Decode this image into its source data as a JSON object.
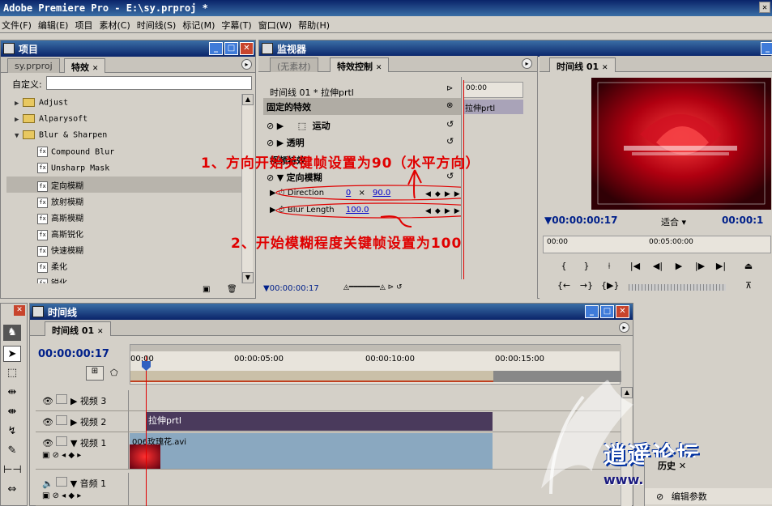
{
  "app": {
    "title": "Adobe Premiere Pro - E:\\sy.prproj *"
  },
  "menu": [
    "文件(F)",
    "编辑(E)",
    "项目",
    "素材(C)",
    "时间线(S)",
    "标记(M)",
    "字幕(T)",
    "窗口(W)",
    "帮助(H)"
  ],
  "project_panel": {
    "title": "项目",
    "tabs": [
      "sy.prproj",
      "特效"
    ],
    "search_label": "自定义:",
    "tree": [
      {
        "label": "Adjust",
        "type": "folder",
        "expanded": false
      },
      {
        "label": "Alparysoft",
        "type": "folder",
        "expanded": false
      },
      {
        "label": "Blur & Sharpen",
        "type": "folder",
        "expanded": true
      },
      {
        "label": "Compound Blur",
        "type": "effect"
      },
      {
        "label": "Unsharp Mask",
        "type": "effect"
      },
      {
        "label": "定向模糊",
        "type": "effect",
        "selected": true
      },
      {
        "label": "放射模糊",
        "type": "effect"
      },
      {
        "label": "高斯模糊",
        "type": "effect"
      },
      {
        "label": "高斯锐化",
        "type": "effect"
      },
      {
        "label": "快速模糊",
        "type": "effect"
      },
      {
        "label": "柔化",
        "type": "effect"
      },
      {
        "label": "锐化",
        "type": "effect"
      }
    ]
  },
  "monitor_panel": {
    "title": "监视器",
    "tabs": [
      "(无素材)",
      "特效控制"
    ],
    "effect_controls": {
      "clip_path": "时间线 01 * 拉伸prtl",
      "fixed_effects": "固定的特效",
      "rows": [
        "运动",
        "透明"
      ],
      "video_effects": "视频特效",
      "effect_name": "定向模糊",
      "params": [
        {
          "name": "Direction",
          "v1": "0",
          "x": "×",
          "v2": "90.0"
        },
        {
          "name": "Blur Length",
          "v1": "100.0"
        }
      ],
      "mini_ruler": "00:00",
      "mini_clip": "拉伸prtl",
      "timecode": "00:00:00:17"
    }
  },
  "program_panel": {
    "tab": "时间线 01",
    "timecode": "00:00:00:17",
    "fit": "适合",
    "end_timecode": "00:00:1",
    "ruler": [
      "00:00",
      "00:05:00:00"
    ]
  },
  "annotations": [
    "1、方向开始关键帧设置为90（水平方向）",
    "2、开始模糊程度关键帧设置为100"
  ],
  "timeline": {
    "title": "时间线",
    "tab": "时间线 01",
    "timecode": "00:00:00:17",
    "ruler": [
      "00:00",
      "00:00:05:00",
      "00:00:10:00",
      "00:00:15:00"
    ],
    "tracks": [
      {
        "name": "视频 3"
      },
      {
        "name": "视频 2",
        "clip": "拉伸prtl"
      },
      {
        "name": "视频 1",
        "clip": "006玫瑰花.avi"
      },
      {
        "name": "音频 1"
      }
    ]
  },
  "history": {
    "title": "历史",
    "item": "编辑参数"
  },
  "watermark": "www.lucan.cn",
  "colors": {
    "title_blue": "#0a246a",
    "annotation_red": "#e00000",
    "clip_purple": "#4a3a5c",
    "clip_video": "#6a8aa8"
  }
}
